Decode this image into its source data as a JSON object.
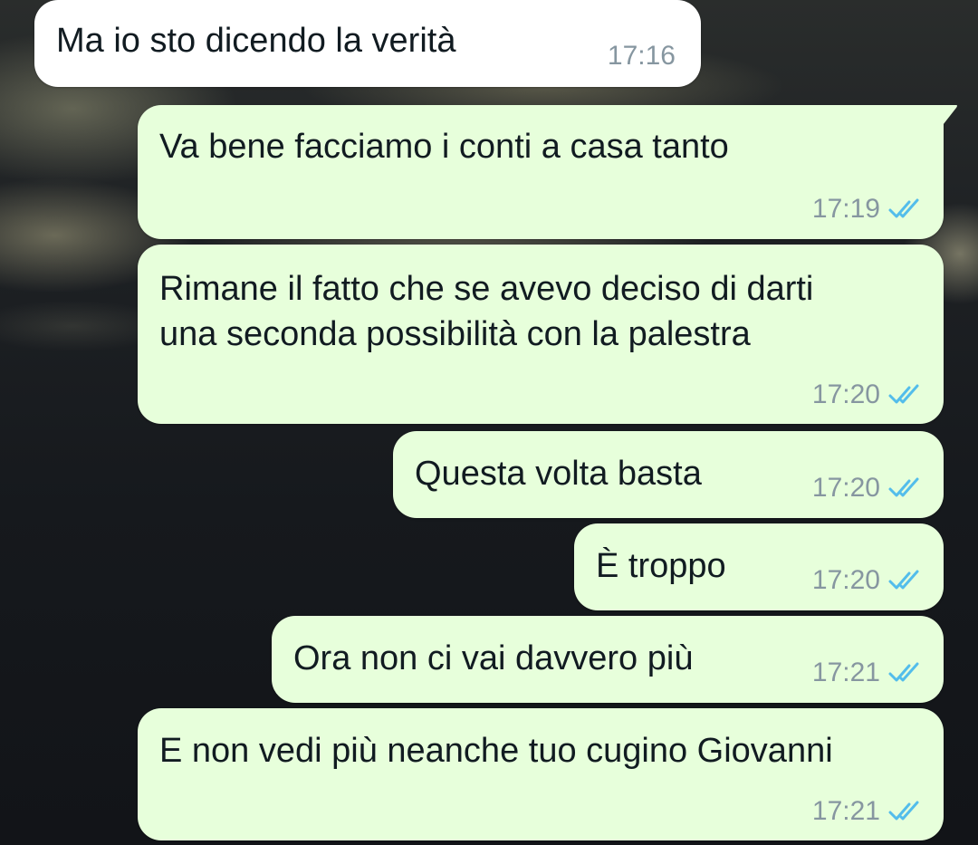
{
  "conversation": {
    "messages": [
      {
        "direction": "incoming",
        "text": "Ma io sto dicendo la verità",
        "time": "17:16"
      },
      {
        "direction": "outgoing",
        "text": "Va bene facciamo i conti a casa tanto",
        "time": "17:19",
        "status": "read"
      },
      {
        "direction": "outgoing",
        "text_lines": [
          "Rimane il fatto che se avevo deciso di darti",
          "una seconda possibilità con la palestra"
        ],
        "time": "17:20",
        "status": "read"
      },
      {
        "direction": "outgoing",
        "text": "Questa volta basta",
        "time": "17:20",
        "status": "read"
      },
      {
        "direction": "outgoing",
        "text": "È troppo",
        "time": "17:20",
        "status": "read"
      },
      {
        "direction": "outgoing",
        "text": "Ora non ci vai davvero più",
        "time": "17:21",
        "status": "read"
      },
      {
        "direction": "outgoing",
        "text": "E non vedi più neanche tuo cugino Giovanni",
        "time": "17:21",
        "status": "read"
      }
    ]
  },
  "theme": {
    "incoming_bubble": "#ffffff",
    "outgoing_bubble": "#e7ffdb",
    "timestamp_color": "#8696a0",
    "read_ticks_color": "#53bdeb"
  },
  "icons": {
    "read_status": "double-check-icon"
  }
}
